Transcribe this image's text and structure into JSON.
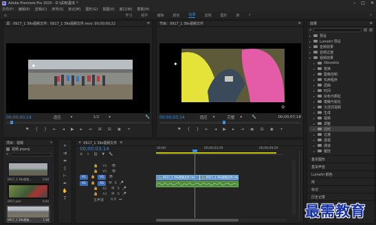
{
  "title": "Adobe Premiere Pro 2020 - D:\\试用\\副本 *",
  "menu": [
    "文件(F)",
    "编辑(E)",
    "剪辑(C)",
    "序列(S)",
    "标记(M)",
    "图形(G)",
    "视图(V)",
    "窗口(W)",
    "帮助(H)"
  ],
  "workspaces": [
    "学习",
    "组件",
    "编辑",
    "颜色",
    "效果",
    "音频",
    "图形",
    "库"
  ],
  "workspace_active": "效果",
  "source": {
    "tab": "源：0917_1 39s视频文件：0917_1 39s视频文件.mov: 00;00;00;22",
    "timecode": "00;00;00;14",
    "fit": "适应",
    "ratio": "1/2"
  },
  "program": {
    "tab": "节目：0917_1 39s视频文件",
    "timecode": "00;00;03;14",
    "fit": "适应",
    "quality": "完整",
    "duration": "00;00;07;18"
  },
  "project": {
    "tab": "项目：视频",
    "file": "视频.prproj",
    "thumbs": [
      {
        "name": "0917_1 39s视频...",
        "dur": "0;00"
      },
      {
        "name": "0917.prel",
        "dur": "0;00"
      },
      {
        "name": "0917_1 39s视频...",
        "dur": "7;18"
      }
    ]
  },
  "timeline": {
    "tab": "0917_1 39s视频文件",
    "timecode": "00;00;03;14",
    "ruler_start": "00;00",
    "ruler_mid": "00;00;04;29",
    "ruler_end": "00;00;09;29",
    "v_tracks": [
      "V3",
      "V2",
      "V1"
    ],
    "a_tracks": [
      "A1",
      "A2",
      "A3"
    ],
    "src_v": "V1",
    "src_a": "A1",
    "master": "主声道",
    "master_val": "0.0",
    "clip1": "0917_1 39s视频文件.mo",
    "clip2": "0917_1 39s视频文件.mo"
  },
  "effects": {
    "tab": "效果",
    "items": [
      {
        "label": "预设",
        "indent": 1,
        "open": false
      },
      {
        "label": "Lumetri 预设",
        "indent": 1,
        "open": false
      },
      {
        "label": "音频效果",
        "indent": 1,
        "open": false
      },
      {
        "label": "音频过渡",
        "indent": 1,
        "open": false
      },
      {
        "label": "视频效果",
        "indent": 1,
        "open": true
      },
      {
        "label": "Obsolete",
        "indent": 2,
        "open": false
      },
      {
        "label": "变换",
        "indent": 2,
        "open": false
      },
      {
        "label": "图像控制",
        "indent": 2,
        "open": false
      },
      {
        "label": "实用程序",
        "indent": 2,
        "open": false
      },
      {
        "label": "扭曲",
        "indent": 2,
        "open": false
      },
      {
        "label": "时间",
        "indent": 2,
        "open": false
      },
      {
        "label": "杂色与颗粒",
        "indent": 2,
        "open": false
      },
      {
        "label": "模糊与锐化",
        "indent": 2,
        "open": false
      },
      {
        "label": "沉浸式视频",
        "indent": 2,
        "open": false
      },
      {
        "label": "生成",
        "indent": 2,
        "open": false
      },
      {
        "label": "视频",
        "indent": 2,
        "open": false
      },
      {
        "label": "调整",
        "indent": 2,
        "open": false
      },
      {
        "label": "过时",
        "indent": 2,
        "open": true,
        "selected": true
      },
      {
        "label": "过渡",
        "indent": 2,
        "open": false
      },
      {
        "label": "透视",
        "indent": 2,
        "open": false
      },
      {
        "label": "通道",
        "indent": 2,
        "open": false
      },
      {
        "label": "键控",
        "indent": 2,
        "open": false
      }
    ],
    "bottom": [
      "基本图形",
      "基本声音",
      "Lumetri 颜色",
      "库",
      "标记",
      "历史记录",
      "信息"
    ]
  },
  "watermark": "最需教育"
}
